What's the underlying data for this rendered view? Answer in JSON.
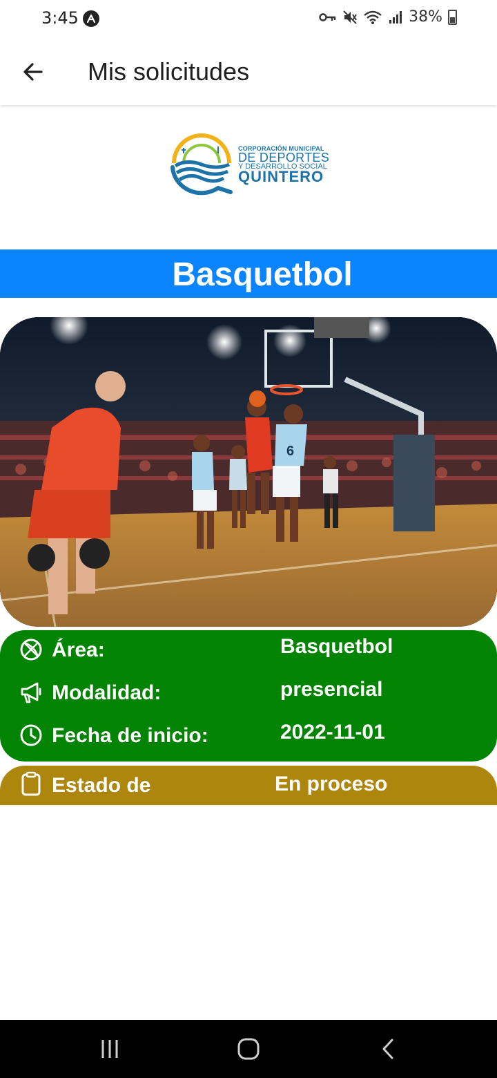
{
  "status_bar": {
    "time": "3:45",
    "battery": "38%"
  },
  "app_bar": {
    "title": "Mis solicitudes",
    "back_icon": "arrow-left-icon"
  },
  "logo": {
    "line1": "CORPORACIÓN MUNICIPAL",
    "line2": "DE DEPORTES",
    "line3": "Y DESARROLLO SOCIAL",
    "line4": "QUINTERO"
  },
  "sport": {
    "title": "Basquetbol"
  },
  "details": {
    "rows": [
      {
        "icon": "basketball-icon",
        "label": "Área:",
        "value": "Basquetbol"
      },
      {
        "icon": "megaphone-icon",
        "label": "Modalidad:",
        "value": "presencial"
      },
      {
        "icon": "clock-icon",
        "label": "Fecha de inicio:",
        "value": "2022-11-01"
      }
    ]
  },
  "status": {
    "icon": "clipboard-icon",
    "label": "Estado de",
    "value": "En proceso"
  },
  "colors": {
    "banner": "#0a84ff",
    "details_card": "#028402",
    "status_card": "#ad860e"
  }
}
